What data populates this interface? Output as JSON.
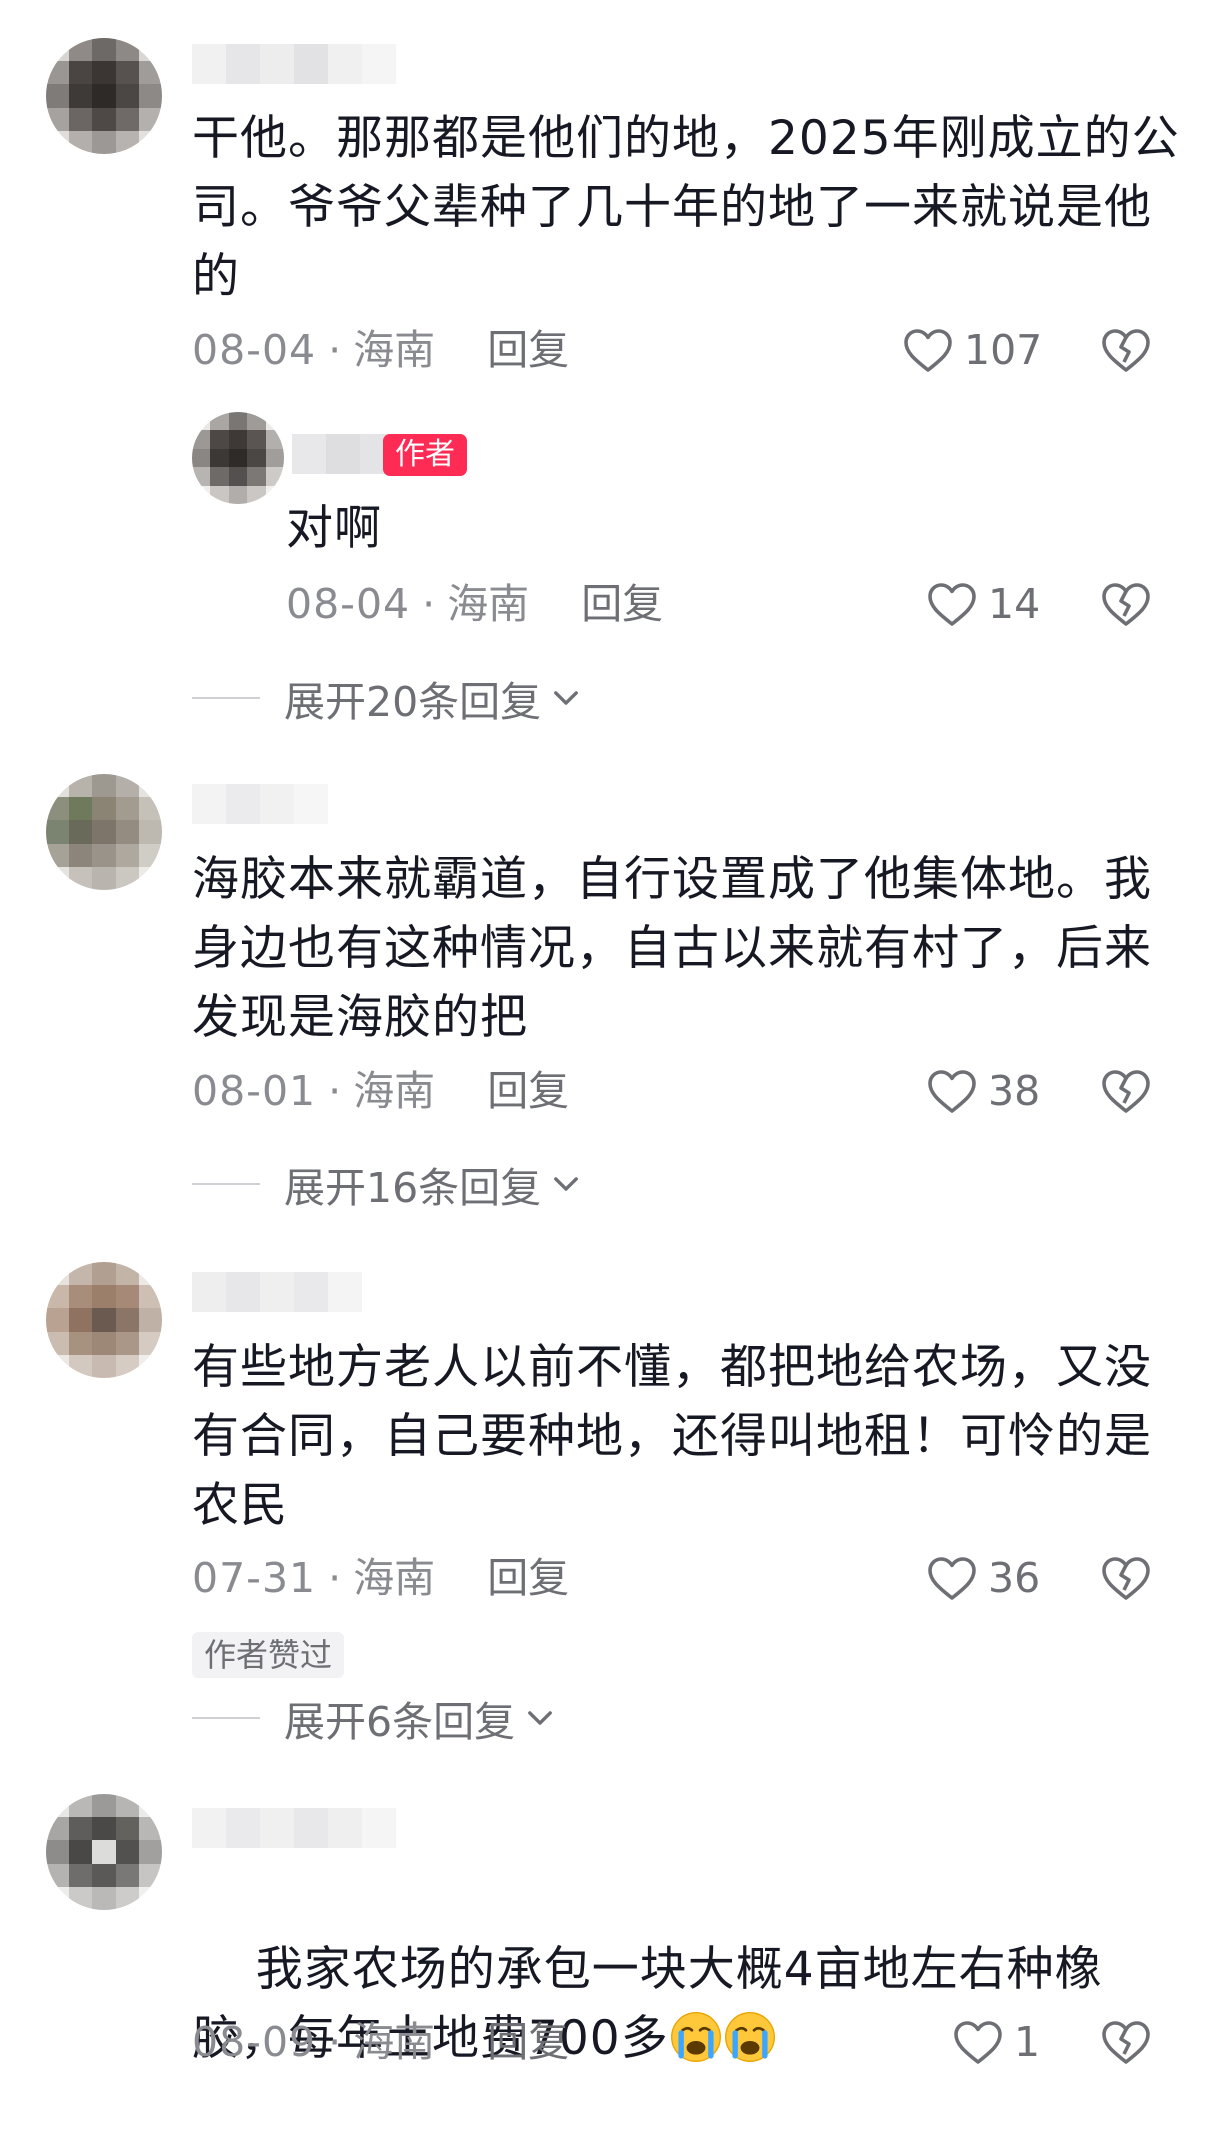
{
  "comments": [
    {
      "text": "干他。那那都是他们的地，2025年刚成立的公司。爷爷父辈种了几十年的地了一来就说是他的",
      "date": "08-04",
      "location": "海南",
      "reply_label": "回复",
      "likes": "107",
      "reply": {
        "badge": "作者",
        "text": "对啊",
        "date": "08-04",
        "location": "海南",
        "reply_label": "回复",
        "likes": "14"
      },
      "expand_label": "展开20条回复"
    },
    {
      "text": "海胶本来就霸道，自行设置成了他集体地。我身边也有这种情况，自古以来就有村了，后来发现是海胶的把",
      "date": "08-01",
      "location": "海南",
      "reply_label": "回复",
      "likes": "38",
      "expand_label": "展开16条回复"
    },
    {
      "text": "有些地方老人以前不懂，都把地给农场，又没有合同，自己要种地，还得叫地租！可怜的是农民",
      "date": "07-31",
      "location": "海南",
      "reply_label": "回复",
      "likes": "36",
      "liked_tag": "作者赞过",
      "expand_label": "展开6条回复"
    },
    {
      "text": "我家农场的承包一块大概4亩地左右种橡胶，每年土地费700多",
      "emoji": [
        "crying-emoji",
        "crying-emoji"
      ],
      "date": "08-09",
      "location": "海南",
      "reply_label": "回复",
      "likes": "1"
    }
  ],
  "separator": "·",
  "icons": {
    "like": "heart-outline-icon",
    "dislike": "broken-heart-icon",
    "expand": "chevron-down-icon"
  },
  "colors": {
    "text": "#161823",
    "meta": "#8a8b91",
    "author_badge": "#fe2c55"
  }
}
